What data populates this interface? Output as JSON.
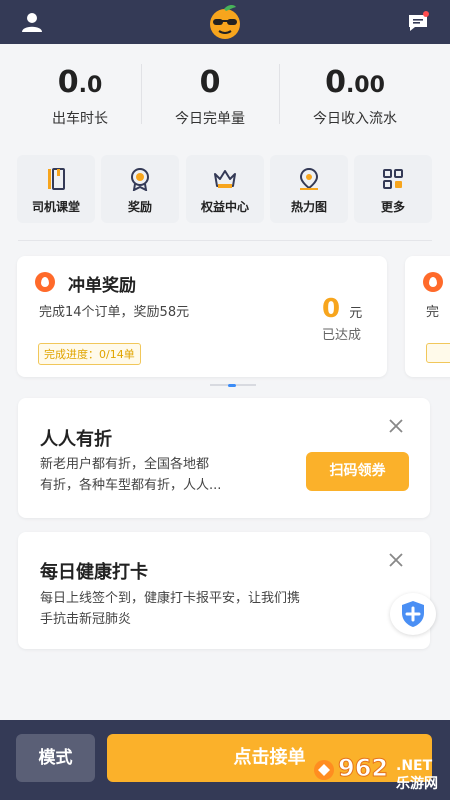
{
  "stats": [
    {
      "value_main": "0",
      "value_small": ".0",
      "label": "出车时长"
    },
    {
      "value_main": "0",
      "value_small": "",
      "label": "今日完单量"
    },
    {
      "value_main": "0",
      "value_small": ".00",
      "label": "今日收入流水"
    }
  ],
  "quick": [
    {
      "label": "司机课堂",
      "icon": "book-icon"
    },
    {
      "label": "奖励",
      "icon": "medal-icon"
    },
    {
      "label": "权益中心",
      "icon": "crown-icon"
    },
    {
      "label": "热力图",
      "icon": "map-pin-icon"
    },
    {
      "label": "更多",
      "icon": "grid-icon"
    }
  ],
  "reward_card": {
    "title": "冲单奖励",
    "desc": "完成14个订单，奖励58元",
    "amount": "0",
    "unit": "元",
    "status": "已达成",
    "progress": "完成进度：0/14单"
  },
  "reward_card_peek": {
    "desc_fragment": "完"
  },
  "promo_card": {
    "title": "人人有折",
    "desc_line1": "新老用户都有折，全国各地都",
    "desc_line2": "有折，各种车型都有折，人人...",
    "button": "扫码领券"
  },
  "health_card": {
    "title": "每日健康打卡",
    "desc_line1": "每日上线签个到，健康打卡报平安，让我们携",
    "desc_line2": "手抗击新冠肺炎"
  },
  "bottom": {
    "mode": "模式",
    "accept": "点击接单"
  },
  "watermark": {
    "text_main": "962",
    "text_net": ".NET",
    "text_cn": "乐游网"
  },
  "colors": {
    "topbar": "#343a56",
    "accent": "#fbb12a",
    "fire": "#ff6a2a",
    "link_blue": "#3c8cf6"
  }
}
